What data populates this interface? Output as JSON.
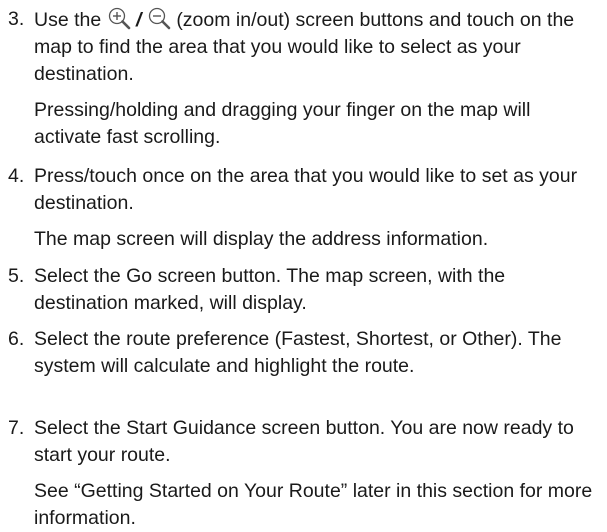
{
  "steps": [
    {
      "number": "3.",
      "text_pre": "Use the",
      "zoom_in_icon": "zoom-in-icon",
      "slash": "/",
      "zoom_out_icon": "zoom-out-icon",
      "text_post": "(zoom in/out) screen buttons and touch on the map to find the area that you would like to select as your destination.",
      "note": "Pressing/holding and dragging your finger on the map will activate fast scrolling."
    },
    {
      "number": "4.",
      "text": "Press/touch once on the area that you would like to set as your destination.",
      "note": "The map screen will display the address information."
    },
    {
      "number": "5.",
      "text": "Select the Go screen button. The map screen, with the destination marked, will display."
    },
    {
      "number": "6.",
      "text": "Select the route preference (Fastest, Shortest, or Other). The system will calculate and highlight the route."
    },
    {
      "number": "7.",
      "text": "Select the Start Guidance screen button. You are now ready to start your route.",
      "note": "See “Getting Started on Your Route” later in this section for more information."
    }
  ]
}
